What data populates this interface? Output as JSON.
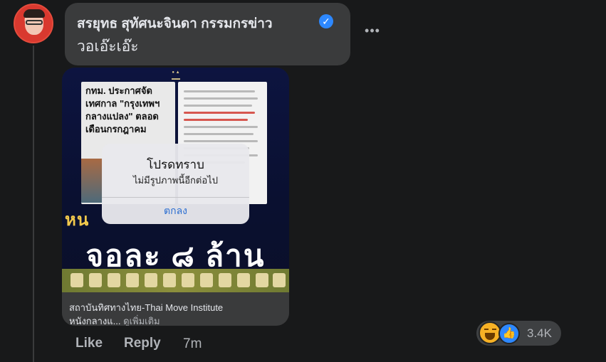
{
  "comment": {
    "author": "สรยุทธ สุทัศนะจินดา กรรมกรข่าว",
    "text": "วอเอ๊ะเอ๊ะ",
    "time": "7m",
    "actions": {
      "like": "Like",
      "reply": "Reply"
    },
    "reaction_count": "3.4K"
  },
  "link_preview": {
    "image": {
      "headline": "กทม. ประกาศจัดเทศกาล \"กรุงเทพฯ กลางแปลง\" ตลอดเดือนกรกฎาคม",
      "big_text_1": "หน",
      "big_text_2": "จอละ ๘ ล้าน"
    },
    "dialog": {
      "title": "โปรดทราบ",
      "message": "ไม่มีรูปภาพนี้อีกต่อไป",
      "button": "ตกลง"
    },
    "source": "สถาบันทิศทางไทย-Thai Move Institute",
    "snippet": "หนังกลางแ...",
    "see_more": "ดูเพิ่มเติม"
  },
  "icons": {
    "verified": "verified-badge-icon",
    "more": "more-options-icon",
    "haha": "haha-reaction-icon",
    "like": "like-reaction-icon"
  },
  "colors": {
    "accent": "#2d88ff",
    "haha": "#f7b125",
    "background": "#18191a",
    "bubble": "#3a3b3c"
  }
}
